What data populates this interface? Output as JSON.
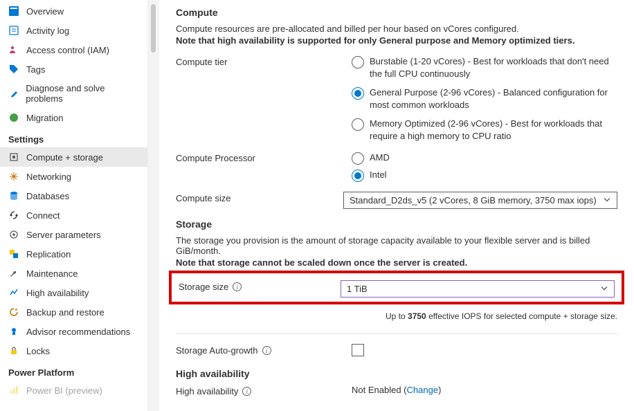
{
  "sidebar": {
    "items": [
      {
        "label": "Overview"
      },
      {
        "label": "Activity log"
      },
      {
        "label": "Access control (IAM)"
      },
      {
        "label": "Tags"
      },
      {
        "label": "Diagnose and solve problems"
      },
      {
        "label": "Migration"
      }
    ],
    "settings_heading": "Settings",
    "settings": [
      {
        "label": "Compute + storage"
      },
      {
        "label": "Networking"
      },
      {
        "label": "Databases"
      },
      {
        "label": "Connect"
      },
      {
        "label": "Server parameters"
      },
      {
        "label": "Replication"
      },
      {
        "label": "Maintenance"
      },
      {
        "label": "High availability"
      },
      {
        "label": "Backup and restore"
      },
      {
        "label": "Advisor recommendations"
      },
      {
        "label": "Locks"
      }
    ],
    "power_heading": "Power Platform",
    "power": [
      {
        "label": "Power BI (preview)"
      }
    ]
  },
  "compute": {
    "title": "Compute",
    "desc": "Compute resources are pre-allocated and billed per hour based on vCores configured.",
    "note": "Note that high availability is supported for only General purpose and Memory optimized tiers.",
    "tier_label": "Compute tier",
    "tiers": [
      "Burstable (1-20 vCores) - Best for workloads that don't need the full CPU continuously",
      "General Purpose (2-96 vCores) - Balanced configuration for most common workloads",
      "Memory Optimized (2-96 vCores) - Best for workloads that require a high memory to CPU ratio"
    ],
    "processor_label": "Compute Processor",
    "processors": [
      "AMD",
      "Intel"
    ],
    "size_label": "Compute size",
    "size_value": "Standard_D2ds_v5 (2 vCores, 8 GiB memory, 3750 max iops)"
  },
  "storage": {
    "title": "Storage",
    "desc": "The storage you provision is the amount of storage capacity available to your flexible server and is billed GiB/month.",
    "note": "Note that storage cannot be scaled down once the server is created.",
    "size_label": "Storage size",
    "size_value": "1 TiB",
    "iops_prefix": "Up to ",
    "iops_value": "3750",
    "iops_suffix": " effective IOPS for selected compute + storage size.",
    "autogrowth_label": "Storage Auto-growth"
  },
  "ha": {
    "title": "High availability",
    "label": "High availability",
    "value": "Not Enabled",
    "change": "Change"
  }
}
